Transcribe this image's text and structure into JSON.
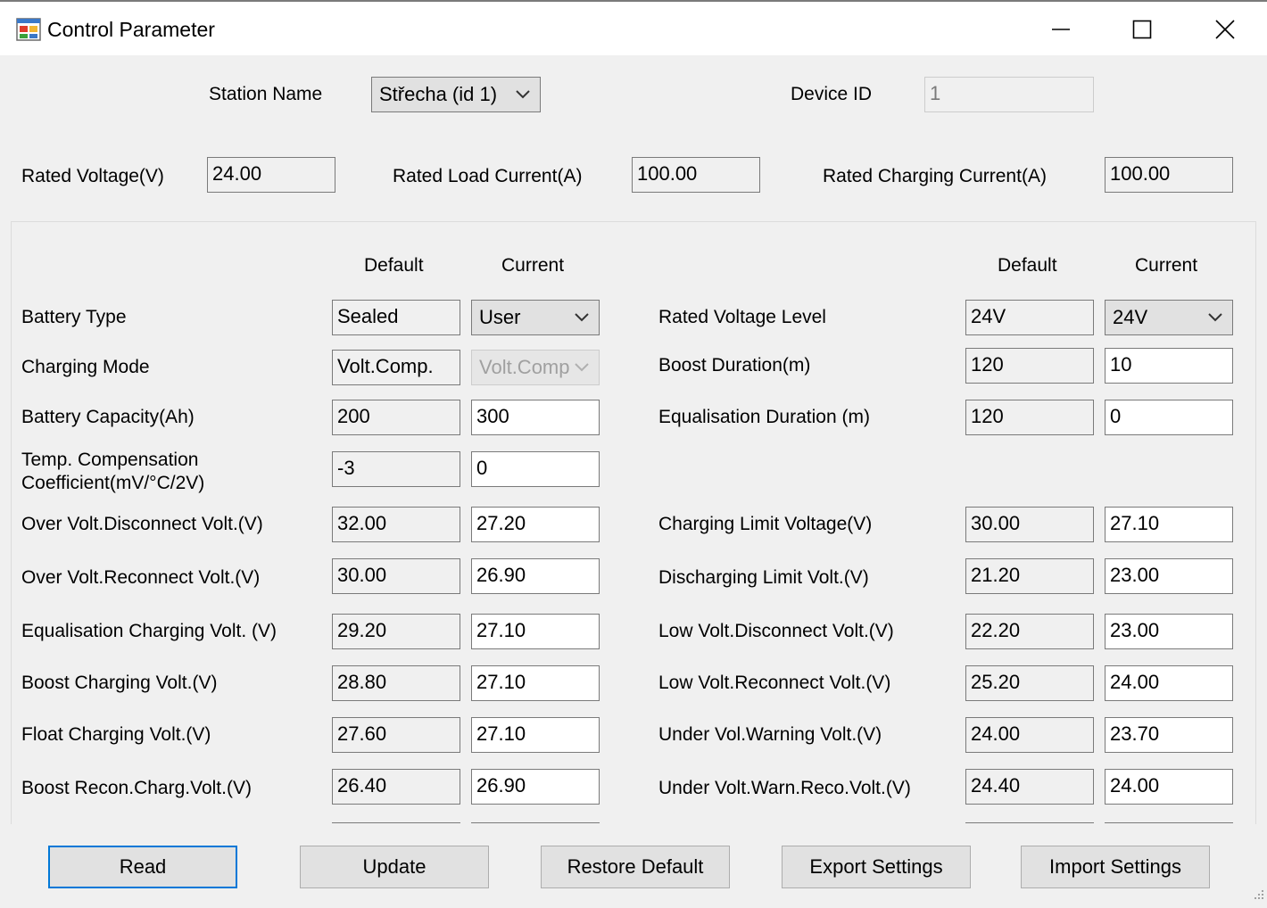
{
  "window": {
    "title": "Control Parameter",
    "icons": [
      "app-icon",
      "minimize-icon",
      "maximize-icon",
      "close-icon"
    ]
  },
  "station": {
    "name_label": "Station Name",
    "name_value": "Střecha (id 1)",
    "device_id_label": "Device ID",
    "device_id_value": "1"
  },
  "rated": {
    "voltage_label": "Rated Voltage(V)",
    "voltage_value": "24.00",
    "load_current_label": "Rated Load Current(A)",
    "load_current_value": "100.00",
    "charging_current_label": "Rated Charging Current(A)",
    "charging_current_value": "100.00"
  },
  "headers": {
    "left_default": "Default",
    "left_current": "Current",
    "right_default": "Default",
    "right_current": "Current"
  },
  "left_rows": [
    {
      "label": "Battery Type",
      "default": "Sealed",
      "current": "User"
    },
    {
      "label": "Charging Mode",
      "default": "Volt.Comp.",
      "current": "Volt.Comp"
    },
    {
      "label": "Battery Capacity(Ah)",
      "default": "200",
      "current": "300"
    },
    {
      "label_line1": "Temp. Compensation",
      "label_line2": "Coefficient(mV/°C/2V)",
      "default": "-3",
      "current": "0"
    },
    {
      "label": "Over Volt.Disconnect Volt.(V)",
      "default": "32.00",
      "current": "27.20"
    },
    {
      "label": "Over Volt.Reconnect Volt.(V)",
      "default": "30.00",
      "current": "26.90"
    },
    {
      "label": "Equalisation Charging Volt. (V)",
      "default": "29.20",
      "current": "27.10"
    },
    {
      "label": "Boost Charging Volt.(V)",
      "default": "28.80",
      "current": "27.10"
    },
    {
      "label": "Float Charging Volt.(V)",
      "default": "27.60",
      "current": "27.10"
    },
    {
      "label": "Boost Recon.Charg.Volt.(V)",
      "default": "26.40",
      "current": "26.90"
    }
  ],
  "right_rows": [
    {
      "label": "Rated Voltage Level",
      "default": "24V",
      "current": "24V"
    },
    {
      "label": "Boost Duration(m)",
      "default": "120",
      "current": "10"
    },
    {
      "label": "Equalisation Duration (m)",
      "default": "120",
      "current": "0"
    },
    {
      "label": "Charging Limit Voltage(V)",
      "default": "30.00",
      "current": "27.10"
    },
    {
      "label": "Discharging Limit Volt.(V)",
      "default": "21.20",
      "current": "23.00"
    },
    {
      "label": "Low Volt.Disconnect Volt.(V)",
      "default": "22.20",
      "current": "23.00"
    },
    {
      "label": "Low Volt.Reconnect Volt.(V)",
      "default": "25.20",
      "current": "24.00"
    },
    {
      "label": "Under Vol.Warning Volt.(V)",
      "default": "24.00",
      "current": "23.70"
    },
    {
      "label": "Under Volt.Warn.Reco.Volt.(V)",
      "default": "24.40",
      "current": "24.00"
    }
  ],
  "buttons": {
    "read": "Read",
    "update": "Update",
    "restore": "Restore Default",
    "export": "Export Settings",
    "import": "Import Settings"
  },
  "colors": {
    "window_bg": "#f0f0f0",
    "titlebar_bg": "#ffffff",
    "focus_border": "#0078d7",
    "button_bg": "#e1e1e1"
  }
}
